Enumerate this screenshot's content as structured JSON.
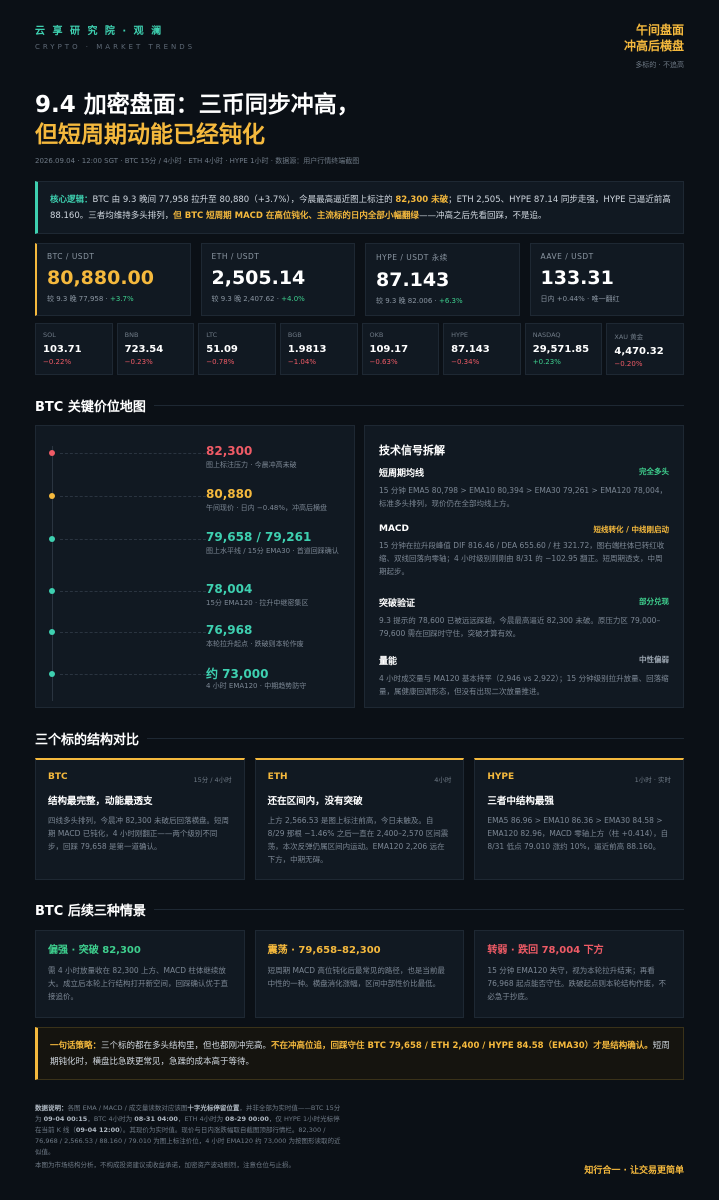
{
  "header": {
    "brand": "云 享 研 究 院 · 观 澜",
    "brand_sub": "CRYPTO · MARKET TRENDS",
    "right_l1": "午间盘面",
    "right_l2": "冲高后横盘",
    "right_l3": "多标的 · 不追高"
  },
  "title": {
    "line1": "9.4 加密盘面：三币同步冲高，",
    "line2": "但短周期动能已经钝化"
  },
  "meta": "2026.09.04 · 12:00 SGT · BTC 15分 / 4小时 · ETH 4小时 · HYPE 1小时 · 数据源：用户行情终端截图",
  "logic": {
    "label": "核心逻辑：",
    "text1": "BTC 由 9.3 晚间 77,958 拉升至 80,880（+3.7%），今晨最高逼近图上标注的 ",
    "hl1": "82,300 未破",
    "text2": "；ETH 2,505、HYPE 87.14 同步走强，HYPE 已逼近前高 88.160。三者均维持多头排列，",
    "hl2": "但 BTC 短周期 MACD 在高位钝化、主流标的日内全部小幅翻绿",
    "text3": "——冲高之后先看回踩，不是追。"
  },
  "big_cards": [
    {
      "pair": "BTC / USDT",
      "price": "80,880.00",
      "ref": "较 9.3 晚 77,958 · ",
      "chg": "+3.7%"
    },
    {
      "pair": "ETH / USDT",
      "price": "2,505.14",
      "ref": "较 9.3 晚 2,407.62 · ",
      "chg": "+4.0%"
    },
    {
      "pair": "HYPE / USDT 永续",
      "price": "87.143",
      "ref": "较 9.3 晚 82.006 · ",
      "chg": "+6.3%"
    },
    {
      "pair": "AAVE / USDT",
      "price": "133.31",
      "ref": "日内 +0.44% · 唯一翻红",
      "chg": ""
    }
  ],
  "small_cards": [
    {
      "name": "SOL",
      "price": "103.71",
      "chg": "−0.22%",
      "up": false
    },
    {
      "name": "BNB",
      "price": "723.54",
      "chg": "−0.23%",
      "up": false
    },
    {
      "name": "LTC",
      "price": "51.09",
      "chg": "−0.78%",
      "up": false
    },
    {
      "name": "BGB",
      "price": "1.9813",
      "chg": "−1.04%",
      "up": false
    },
    {
      "name": "OKB",
      "price": "109.17",
      "chg": "−0.63%",
      "up": false
    },
    {
      "name": "HYPE",
      "price": "87.143",
      "chg": "−0.34%",
      "up": false
    },
    {
      "name": "NASDAQ",
      "price": "29,571.85",
      "chg": "+0.23%",
      "up": true
    },
    {
      "name": "XAU 黄金",
      "price": "4,470.32",
      "chg": "−0.20%",
      "up": false
    }
  ],
  "sections": {
    "map": "BTC 关键价位地图",
    "compare": "三个标的结构对比",
    "scenarios": "BTC 后续三种情景"
  },
  "levels": [
    {
      "price": "82,300",
      "desc": "图上标注压力 · 今晨冲高未破",
      "color": "#ef5b66"
    },
    {
      "price": "80,880",
      "desc": "午间现价 · 日内 −0.48%，冲高后横盘",
      "color": "#f5b93d"
    },
    {
      "price": "79,658 / 79,261",
      "desc": "图上水平线 / 15分 EMA30 · 首道回踩确认",
      "color": "#3ed0b0"
    },
    {
      "price": "78,004",
      "desc": "15分 EMA120 · 拉升中继密集区",
      "color": "#3ed0b0"
    },
    {
      "price": "76,968",
      "desc": "本轮拉升起点 · 跌破则本轮作废",
      "color": "#3ed0b0"
    },
    {
      "price": "约 73,000",
      "desc": "4 小时 EMA120 · 中期趋势防守",
      "color": "#3ed0b0"
    }
  ],
  "signals": {
    "title": "技术信号拆解",
    "items": [
      {
        "name": "短周期均线",
        "tag": "完全多头",
        "tag_color": "#3ecf8e",
        "text": "15 分钟 EMA5 80,798 > EMA10 80,394 > EMA30 79,261 > EMA120 78,004，标准多头排列，现价仍在全部均线上方。"
      },
      {
        "name": "MACD",
        "tag": "短线转化 / 中线刚启动",
        "tag_color": "#f5b93d",
        "text": "15 分钟在拉升段峰值 DIF 816.46 / DEA 655.60 / 柱 321.72，图右端柱体已转红收缩、双线回落向零轴；4 小时级别则刚由 8/31 的 −102.95 翻正。短周期透支，中周期起步。"
      },
      {
        "name": "突破验证",
        "tag": "部分兑现",
        "tag_color": "#3ecf8e",
        "text": "9.3 提示的 78,600 已被远远踩越，今晨最高逼近 82,300 未破。原压力区 79,000–79,600 需在回踩时守住，突破才算有效。"
      },
      {
        "name": "量能",
        "tag": "中性偏弱",
        "tag_color": "#9aa4af",
        "text": "4 小时成交量与 MA120 基本持平（2,946 vs 2,922）；15 分钟级别拉升放量、回落缩量，属健康回调形态，但没有出现二次放量推进。"
      }
    ]
  },
  "compare": [
    {
      "name": "BTC",
      "tf": "15分 / 4小时",
      "head": "结构最完整，动能最透支",
      "body": "四线多头排列，今晨冲 82,300 未破后回落横盘。短周期 MACD 已钝化，4 小时刚翻正——两个级别不同步，回踩 79,658 是第一道确认。"
    },
    {
      "name": "ETH",
      "tf": "4小时",
      "head": "还在区间内，没有突破",
      "body": "上方 2,566.53 是图上标注前高，今日未触及。自 8/29 那根 −1.46% 之后一直在 2,400–2,570 区间震荡，本次反弹仍属区间内运动。EMA120 2,206 远在下方，中期无碍。"
    },
    {
      "name": "HYPE",
      "tf": "1小时 · 实时",
      "head": "三者中结构最强",
      "body": "EMA5 86.96 > EMA10 86.36 > EMA30 84.58 > EMA120 82.96，MACD 零轴上方（柱 +0.414），自 8/31 低点 79.010 涨约 10%，逼近前高 88.160。"
    }
  ],
  "scenarios": [
    {
      "head": "偏强 · 突破 82,300",
      "color": "#3ecf8e",
      "body": "需 4 小时放量收在 82,300 上方、MACD 柱体继续放大。成立后本轮上行结构打开新空间，回踩确认优于直接追价。"
    },
    {
      "head": "震荡 · 79,658–82,300",
      "color": "#f5b93d",
      "body": "短周期 MACD 高位钝化后最常见的路径，也是当前最中性的一种。横盘消化涨幅，区间中部性价比最低。"
    },
    {
      "head": "转弱 · 跌回 78,004 下方",
      "color": "#ef5b66",
      "body": "15 分钟 EMA120 失守，视为本轮拉升结束；再看 76,968 起点能否守住。跌破起点则本轮结构作废，不必急于抄底。"
    }
  ],
  "strategy": {
    "label": "一句话策略：",
    "text1": "三个标的都在多头结构里，但也都刚冲完高。",
    "hl1": "不在冲高位追，回踩守住 BTC 79,658 / ETH 2,400 / HYPE 84.58（EMA30）才是结构确认。",
    "text2": "短周期钝化时，横盘比急跌更常见，急躁的成本高于等待。"
  },
  "footer": {
    "label": "数据说明：",
    "t1": "各图 EMA / MACD / 成交量读数对应该图",
    "b1": "十字光标停留位置",
    "t2": "，并非全部为实时值——BTC 15分为 ",
    "b2": "09-04 00:15",
    "t3": "，BTC 4小时为 ",
    "b3": "08-31 04:00",
    "t4": "，ETH 4小时为 ",
    "b4": "08-29 00:00",
    "t5": "，仅 HYPE 1小时光标停在当前 K 线（",
    "b5": "09-04 12:00",
    "t6": "）。其现价为实时值。现价与日内涨跌幅取自截图顶部行情栏。82,300 / 76,968 / 2,566.53 / 88.160 / 79.010 为图上标注价位，4 小时 EMA120 约 73,000 为按图形读取的近似值。",
    "t7": "本图为市场结构分析，不构成投资建议或收益承诺，加密资产波动剧烈，注意仓位与止损。",
    "right": "知行合一 · 让交易更简单"
  }
}
